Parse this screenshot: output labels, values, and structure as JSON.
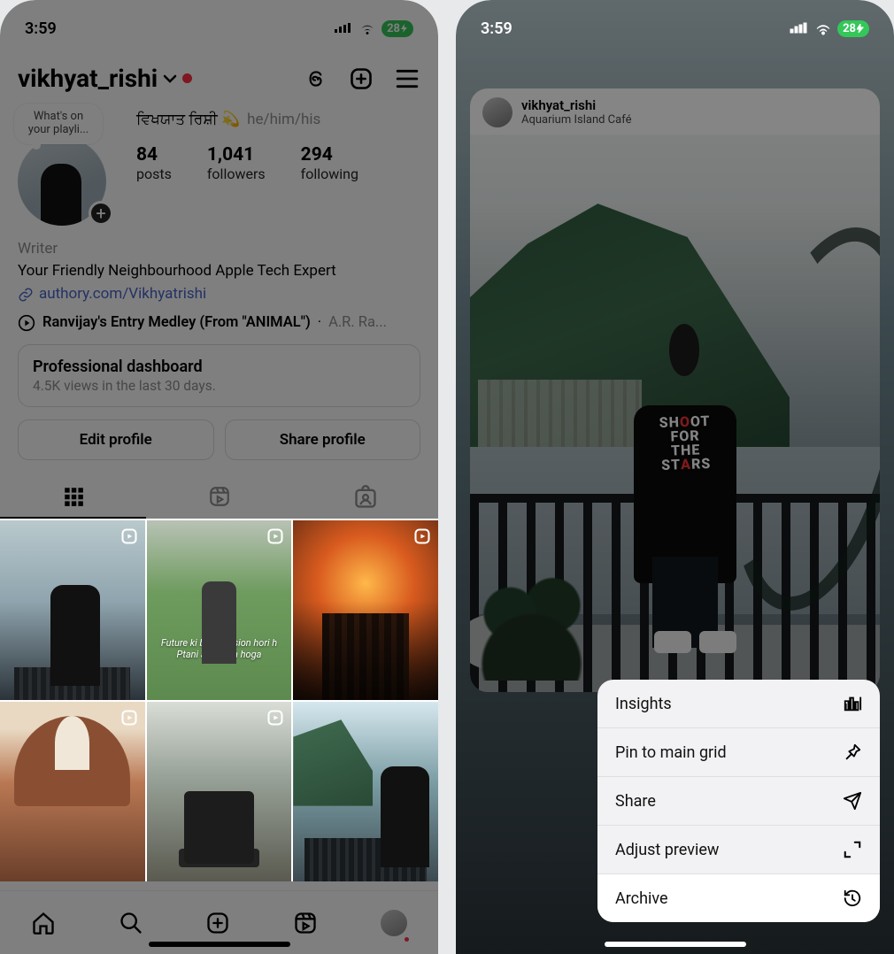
{
  "status": {
    "time": "3:59",
    "battery": "28"
  },
  "left": {
    "username": "vikhyat_rishi",
    "note": "What's on your playli...",
    "display_name": "ਵਿਖਯਾਤ ਰਿਸ਼ੀ 💫",
    "pronouns": "he/him/his",
    "stats": {
      "posts": {
        "count": "84",
        "label": "posts"
      },
      "followers": {
        "count": "1,041",
        "label": "followers"
      },
      "following": {
        "count": "294",
        "label": "following"
      }
    },
    "role": "Writer",
    "bio": "Your Friendly Neighbourhood Apple Tech Expert",
    "link": "authory.com/Vikhyatrishi",
    "music": {
      "title": "Ranvijay's Entry Medley (From \"ANIMAL\")",
      "artist": "A.R. Ra..."
    },
    "dashboard": {
      "title": "Professional dashboard",
      "sub": "4.5K views in the last 30 days."
    },
    "buttons": {
      "edit": "Edit profile",
      "share": "Share profile"
    },
    "grid_caption_2": "I hour:\nFuture ki badi tension hori h\nPtani aage kya hoga"
  },
  "right": {
    "username": "vikhyat_rishi",
    "location": "Aquarium Island Café",
    "shirt_print": "SHOOT FOR THE STARS",
    "menu": {
      "insights": "Insights",
      "pin": "Pin to main grid",
      "share": "Share",
      "adjust": "Adjust preview",
      "archive": "Archive"
    }
  }
}
